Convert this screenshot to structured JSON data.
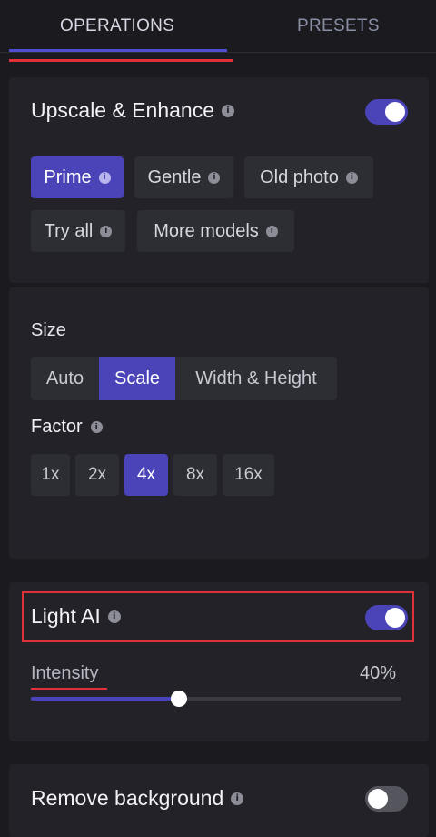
{
  "tabs": {
    "operations": "OPERATIONS",
    "presets": "PRESETS"
  },
  "upscale": {
    "title": "Upscale & Enhance",
    "enabled": true,
    "models": [
      {
        "label": "Prime",
        "active": true
      },
      {
        "label": "Gentle",
        "active": false
      },
      {
        "label": "Old photo",
        "active": false
      },
      {
        "label": "Try all",
        "active": false
      },
      {
        "label": "More models",
        "active": false
      }
    ]
  },
  "size": {
    "label": "Size",
    "options": [
      "Auto",
      "Scale",
      "Width & Height"
    ],
    "selected": "Scale",
    "factor_label": "Factor",
    "factors": [
      "1x",
      "2x",
      "4x",
      "8x",
      "16x"
    ],
    "selected_factor": "4x"
  },
  "light_ai": {
    "title": "Light AI",
    "enabled": true,
    "intensity_label": "Intensity",
    "intensity_value": "40%",
    "intensity_fraction": 0.4
  },
  "remove_background": {
    "title": "Remove background",
    "enabled": false
  },
  "info_glyph": "i",
  "colors": {
    "accent": "#4a44b8",
    "highlight": "#e0313a"
  }
}
